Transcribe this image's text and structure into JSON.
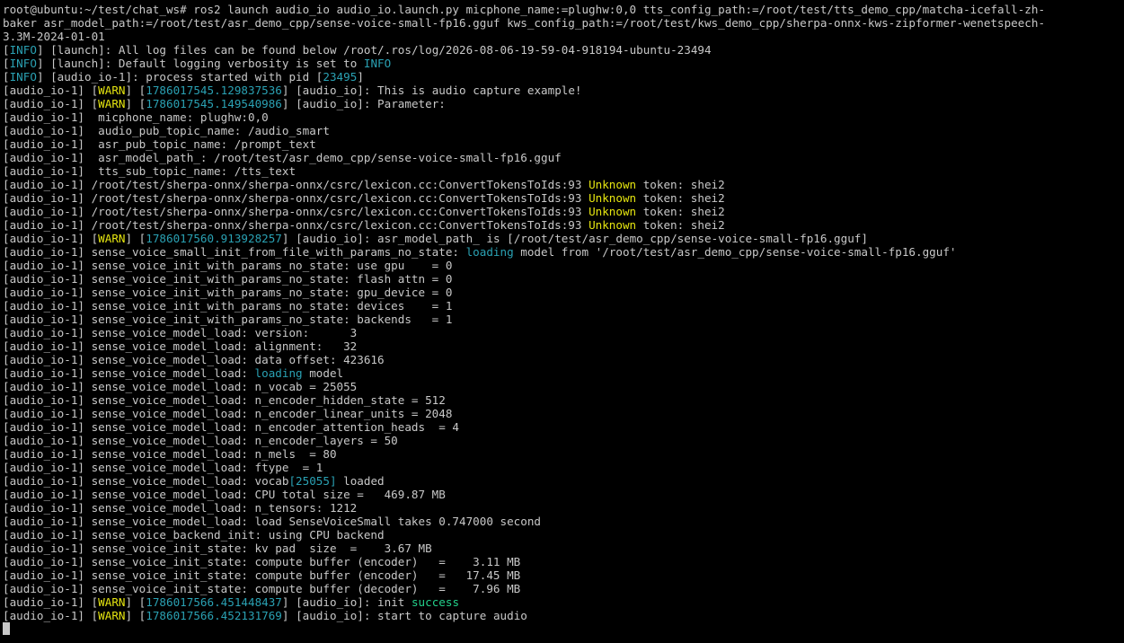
{
  "terminal": {
    "colors": {
      "background": "#000000",
      "foreground": "#c8c8c8",
      "cyan": "#2aa1b3",
      "yellow": "#e5e510",
      "green": "#23d18b"
    },
    "lines": [
      [
        {
          "t": "root@ubuntu:~/test/chat_ws# ros2 launch audio_io audio_io.launch.py micphone_name:=plughw:0,0 tts_config_path:=/root/test/tts_demo_cpp/matcha-icefall-zh-",
          "c": "plain"
        }
      ],
      [
        {
          "t": "baker asr_model_path:=/root/test/asr_demo_cpp/sense-voice-small-fp16.gguf kws_config_path:=/root/test/kws_demo_cpp/sherpa-onnx-kws-zipformer-wenetspeech-",
          "c": "plain"
        }
      ],
      [
        {
          "t": "3.3M-2024-01-01",
          "c": "plain"
        }
      ],
      [
        {
          "t": "[",
          "c": "plain"
        },
        {
          "t": "INFO",
          "c": "cyan"
        },
        {
          "t": "] [launch]: All log files can be found below /root/.ros/log/2026-08-06-19-59-04-918194-ubuntu-23494",
          "c": "plain"
        }
      ],
      [
        {
          "t": "[",
          "c": "plain"
        },
        {
          "t": "INFO",
          "c": "cyan"
        },
        {
          "t": "] [launch]: Default logging verbosity is set to ",
          "c": "plain"
        },
        {
          "t": "INFO",
          "c": "cyan"
        }
      ],
      [
        {
          "t": "[",
          "c": "plain"
        },
        {
          "t": "INFO",
          "c": "cyan"
        },
        {
          "t": "] [audio_io-1]: process started with pid [",
          "c": "plain"
        },
        {
          "t": "23495",
          "c": "cyan"
        },
        {
          "t": "]",
          "c": "plain"
        }
      ],
      [
        {
          "t": "[audio_io-1] [",
          "c": "plain"
        },
        {
          "t": "WARN",
          "c": "yellow"
        },
        {
          "t": "] [",
          "c": "plain"
        },
        {
          "t": "1786017545.129837536",
          "c": "cyan"
        },
        {
          "t": "] [audio_io]: This is audio capture example!",
          "c": "plain"
        }
      ],
      [
        {
          "t": "[audio_io-1] [",
          "c": "plain"
        },
        {
          "t": "WARN",
          "c": "yellow"
        },
        {
          "t": "] [",
          "c": "plain"
        },
        {
          "t": "1786017545.149540986",
          "c": "cyan"
        },
        {
          "t": "] [audio_io]: Parameter:",
          "c": "plain"
        }
      ],
      [
        {
          "t": "[audio_io-1]  micphone_name: plughw:0,0",
          "c": "plain"
        }
      ],
      [
        {
          "t": "[audio_io-1]  audio_pub_topic_name: /audio_smart",
          "c": "plain"
        }
      ],
      [
        {
          "t": "[audio_io-1]  asr_pub_topic_name: /prompt_text",
          "c": "plain"
        }
      ],
      [
        {
          "t": "[audio_io-1]  asr_model_path_: /root/test/asr_demo_cpp/sense-voice-small-fp16.gguf",
          "c": "plain"
        }
      ],
      [
        {
          "t": "[audio_io-1]  tts_sub_topic_name: /tts_text",
          "c": "plain"
        }
      ],
      [
        {
          "t": "[audio_io-1] /root/test/sherpa-onnx/sherpa-onnx/csrc/lexicon.cc:ConvertTokensToIds:93 ",
          "c": "plain"
        },
        {
          "t": "Unknown",
          "c": "yellow"
        },
        {
          "t": " token: shei2",
          "c": "plain"
        }
      ],
      [
        {
          "t": "[audio_io-1] /root/test/sherpa-onnx/sherpa-onnx/csrc/lexicon.cc:ConvertTokensToIds:93 ",
          "c": "plain"
        },
        {
          "t": "Unknown",
          "c": "yellow"
        },
        {
          "t": " token: shei2",
          "c": "plain"
        }
      ],
      [
        {
          "t": "[audio_io-1] /root/test/sherpa-onnx/sherpa-onnx/csrc/lexicon.cc:ConvertTokensToIds:93 ",
          "c": "plain"
        },
        {
          "t": "Unknown",
          "c": "yellow"
        },
        {
          "t": " token: shei2",
          "c": "plain"
        }
      ],
      [
        {
          "t": "[audio_io-1] /root/test/sherpa-onnx/sherpa-onnx/csrc/lexicon.cc:ConvertTokensToIds:93 ",
          "c": "plain"
        },
        {
          "t": "Unknown",
          "c": "yellow"
        },
        {
          "t": " token: shei2",
          "c": "plain"
        }
      ],
      [
        {
          "t": "[audio_io-1] [",
          "c": "plain"
        },
        {
          "t": "WARN",
          "c": "yellow"
        },
        {
          "t": "] [",
          "c": "plain"
        },
        {
          "t": "1786017560.913928257",
          "c": "cyan"
        },
        {
          "t": "] [audio_io]: asr_model_path_ is [/root/test/asr_demo_cpp/sense-voice-small-fp16.gguf]",
          "c": "plain"
        }
      ],
      [
        {
          "t": "[audio_io-1] sense_voice_small_init_from_file_with_params_no_state: ",
          "c": "plain"
        },
        {
          "t": "loading",
          "c": "cyan"
        },
        {
          "t": " model from '/root/test/asr_demo_cpp/sense-voice-small-fp16.gguf'",
          "c": "plain"
        }
      ],
      [
        {
          "t": "[audio_io-1] sense_voice_init_with_params_no_state: use gpu    = 0",
          "c": "plain"
        }
      ],
      [
        {
          "t": "[audio_io-1] sense_voice_init_with_params_no_state: flash attn = 0",
          "c": "plain"
        }
      ],
      [
        {
          "t": "[audio_io-1] sense_voice_init_with_params_no_state: gpu_device = 0",
          "c": "plain"
        }
      ],
      [
        {
          "t": "[audio_io-1] sense_voice_init_with_params_no_state: devices    = 1",
          "c": "plain"
        }
      ],
      [
        {
          "t": "[audio_io-1] sense_voice_init_with_params_no_state: backends   = 1",
          "c": "plain"
        }
      ],
      [
        {
          "t": "[audio_io-1] sense_voice_model_load: version:      3",
          "c": "plain"
        }
      ],
      [
        {
          "t": "[audio_io-1] sense_voice_model_load: alignment:   32",
          "c": "plain"
        }
      ],
      [
        {
          "t": "[audio_io-1] sense_voice_model_load: data offset: 423616",
          "c": "plain"
        }
      ],
      [
        {
          "t": "[audio_io-1] sense_voice_model_load: ",
          "c": "plain"
        },
        {
          "t": "loading",
          "c": "cyan"
        },
        {
          "t": " model",
          "c": "plain"
        }
      ],
      [
        {
          "t": "[audio_io-1] sense_voice_model_load: n_vocab = 25055",
          "c": "plain"
        }
      ],
      [
        {
          "t": "[audio_io-1] sense_voice_model_load: n_encoder_hidden_state = 512",
          "c": "plain"
        }
      ],
      [
        {
          "t": "[audio_io-1] sense_voice_model_load: n_encoder_linear_units = 2048",
          "c": "plain"
        }
      ],
      [
        {
          "t": "[audio_io-1] sense_voice_model_load: n_encoder_attention_heads  = 4",
          "c": "plain"
        }
      ],
      [
        {
          "t": "[audio_io-1] sense_voice_model_load: n_encoder_layers = 50",
          "c": "plain"
        }
      ],
      [
        {
          "t": "[audio_io-1] sense_voice_model_load: n_mels  = 80",
          "c": "plain"
        }
      ],
      [
        {
          "t": "[audio_io-1] sense_voice_model_load: ftype  = 1",
          "c": "plain"
        }
      ],
      [
        {
          "t": "[audio_io-1] sense_voice_model_load: vocab",
          "c": "plain"
        },
        {
          "t": "[25055]",
          "c": "cyan"
        },
        {
          "t": " loaded",
          "c": "plain"
        }
      ],
      [
        {
          "t": "[audio_io-1] sense_voice_model_load: CPU total size =   469.87 MB",
          "c": "plain"
        }
      ],
      [
        {
          "t": "[audio_io-1] sense_voice_model_load: n_tensors: 1212",
          "c": "plain"
        }
      ],
      [
        {
          "t": "[audio_io-1] sense_voice_model_load: load SenseVoiceSmall takes 0.747000 second",
          "c": "plain"
        }
      ],
      [
        {
          "t": "[audio_io-1] sense_voice_backend_init: using CPU backend",
          "c": "plain"
        }
      ],
      [
        {
          "t": "[audio_io-1] sense_voice_init_state: kv pad  size  =    3.67 MB",
          "c": "plain"
        }
      ],
      [
        {
          "t": "[audio_io-1] sense_voice_init_state: compute buffer (encoder)   =    3.11 MB",
          "c": "plain"
        }
      ],
      [
        {
          "t": "[audio_io-1] sense_voice_init_state: compute buffer (encoder)   =   17.45 MB",
          "c": "plain"
        }
      ],
      [
        {
          "t": "[audio_io-1] sense_voice_init_state: compute buffer (decoder)   =    7.96 MB",
          "c": "plain"
        }
      ],
      [
        {
          "t": "[audio_io-1] [",
          "c": "plain"
        },
        {
          "t": "WARN",
          "c": "yellow"
        },
        {
          "t": "] [",
          "c": "plain"
        },
        {
          "t": "1786017566.451448437",
          "c": "cyan"
        },
        {
          "t": "] [audio_io]: init ",
          "c": "plain"
        },
        {
          "t": "success",
          "c": "green"
        }
      ],
      [
        {
          "t": "[audio_io-1] [",
          "c": "plain"
        },
        {
          "t": "WARN",
          "c": "yellow"
        },
        {
          "t": "] [",
          "c": "plain"
        },
        {
          "t": "1786017566.452131769",
          "c": "cyan"
        },
        {
          "t": "] [audio_io]: start to capture audio",
          "c": "plain"
        }
      ]
    ]
  }
}
